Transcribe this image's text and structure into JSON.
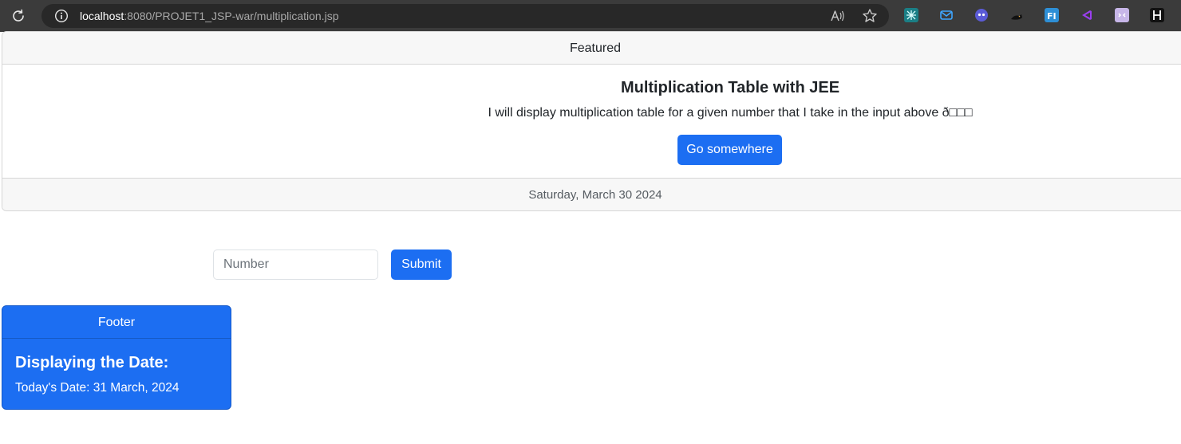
{
  "browser": {
    "url_host": "localhost",
    "url_path": ":8080/PROJET1_JSP-war/multiplication.jsp"
  },
  "featured_card": {
    "header": "Featured",
    "title": "Multiplication Table with JEE",
    "text": "I will display multiplication table for a given number that I take in the input above ð□□□",
    "button_label": "Go somewhere",
    "footer_date": "Saturday, March 30 2024"
  },
  "form": {
    "input_placeholder": "Number",
    "input_value": "",
    "submit_label": "Submit"
  },
  "footer_card": {
    "header": "Footer",
    "title": "Displaying the Date:",
    "text": "Today's Date: 31 March, 2024"
  },
  "colors": {
    "primary_button": "#1c6ef2",
    "browser_toolbar": "#3b3b3b",
    "card_header_bg": "#f7f7f7"
  },
  "icons": {
    "reload": "reload-icon",
    "info": "info-icon",
    "read_aloud": "read-aloud-icon",
    "favorite": "favorite-star-icon",
    "extensions": [
      "grid-extension-icon",
      "mail-extension-icon",
      "ghost-extension-icon",
      "cat-extension-icon",
      "fi-extension-icon",
      "vscode-extension-icon",
      "face-extension-icon",
      "h-extension-icon"
    ]
  }
}
